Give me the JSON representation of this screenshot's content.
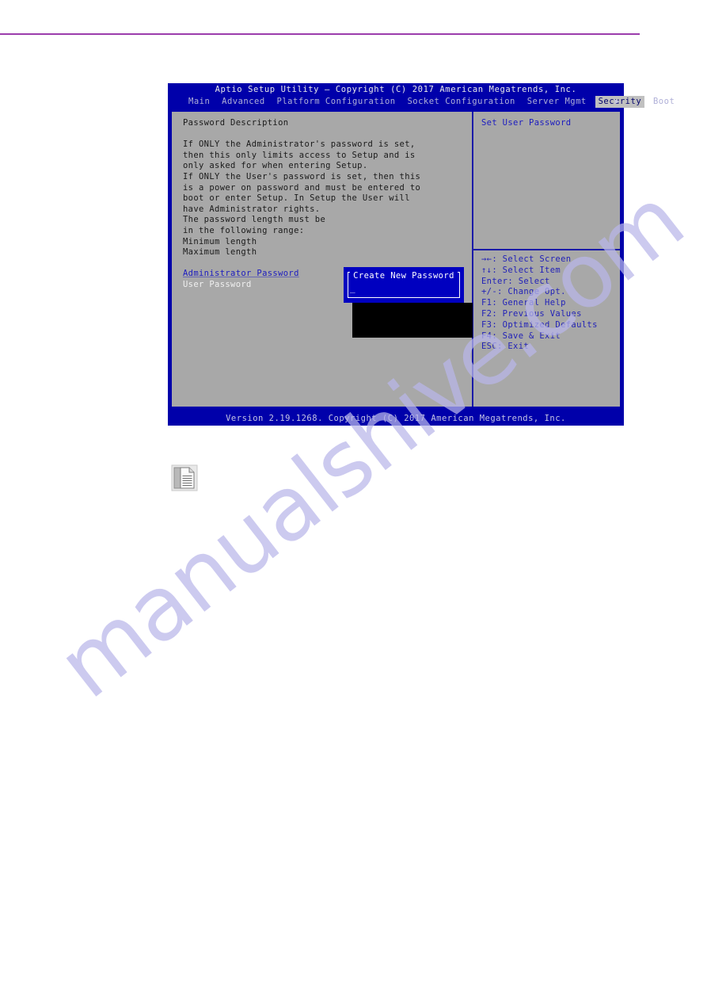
{
  "document": {
    "watermark": "manualshive.com",
    "rule_color": "#9b3dac"
  },
  "bios": {
    "title": "Aptio Setup Utility – Copyright (C) 2017 American Megatrends, Inc.",
    "tabs": [
      {
        "label": "Main",
        "active": false
      },
      {
        "label": "Advanced",
        "active": false
      },
      {
        "label": "Platform Configuration",
        "active": false
      },
      {
        "label": "Socket Configuration",
        "active": false
      },
      {
        "label": "Server Mgmt",
        "active": false
      },
      {
        "label": "Security",
        "active": true
      },
      {
        "label": "Boot",
        "active": false
      }
    ],
    "scroll_arrow": "▶",
    "left_pane": {
      "heading": "Password Description",
      "description": [
        "If ONLY the Administrator's password is set,",
        "then this only limits access to Setup and is",
        "only asked for when entering Setup.",
        "If ONLY the User's password is set, then this",
        "is a power on password and must be entered to",
        "boot or enter Setup. In Setup the User will",
        "have Administrator rights.",
        "The password length must be",
        "in the following range:",
        "Minimum length",
        "Maximum length"
      ],
      "items": [
        {
          "label": "Administrator Password",
          "selected": true
        },
        {
          "label": "User Password",
          "selected": false
        }
      ]
    },
    "right_pane": {
      "help_title": "Set User Password",
      "keys": [
        "→←: Select Screen",
        "↑↓: Select Item",
        "Enter: Select",
        "+/-: Change Opt.",
        "F1: General Help",
        "F2: Previous Values",
        "F3: Optimized Defaults",
        "F4: Save & Exit",
        "ESC: Exit"
      ]
    },
    "dialog": {
      "title": "Create New Password",
      "value": "",
      "cursor": "_"
    },
    "footer": "Version 2.19.1268. Copyright (C) 2017 American Megatrends, Inc.",
    "colors": {
      "screen_blue": "#0000aa",
      "panel_gray": "#a8a8a8",
      "dialog_blue": "#0000c0",
      "link_blue": "#1b1bc0"
    }
  }
}
